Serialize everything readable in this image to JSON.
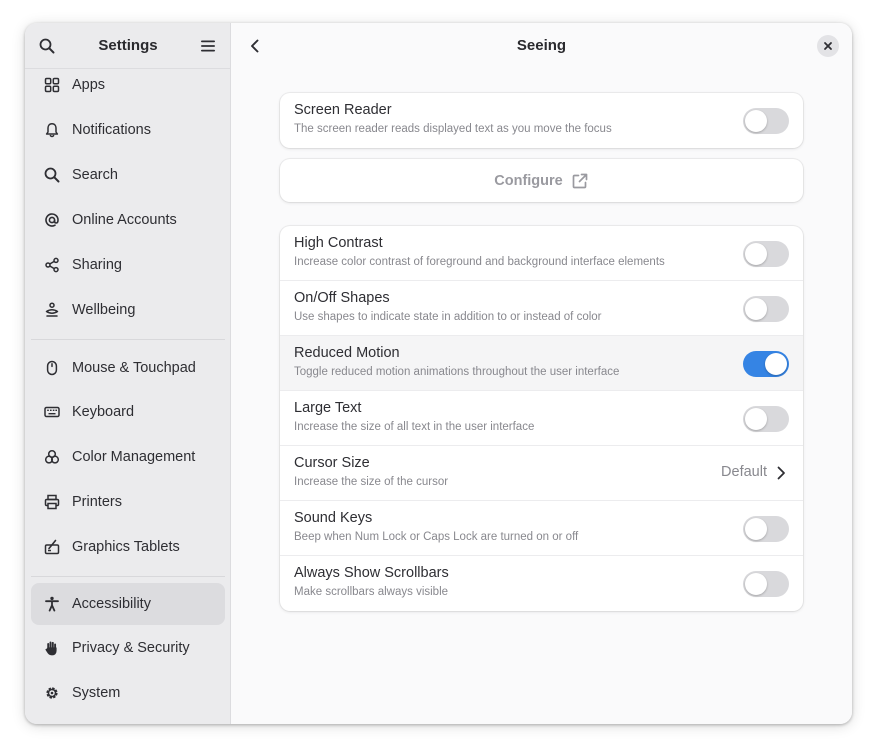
{
  "sidebar": {
    "title": "Settings",
    "items": [
      {
        "label": "Apps",
        "icon": "apps-grid-icon"
      },
      {
        "label": "Notifications",
        "icon": "bell-icon"
      },
      {
        "label": "Search",
        "icon": "search-icon"
      },
      {
        "label": "Online Accounts",
        "icon": "at-sign-icon"
      },
      {
        "label": "Sharing",
        "icon": "share-icon"
      },
      {
        "label": "Wellbeing",
        "icon": "wellbeing-icon"
      },
      {
        "label": "Mouse & Touchpad",
        "icon": "mouse-icon"
      },
      {
        "label": "Keyboard",
        "icon": "keyboard-icon"
      },
      {
        "label": "Color Management",
        "icon": "color-icon"
      },
      {
        "label": "Printers",
        "icon": "printer-icon"
      },
      {
        "label": "Graphics Tablets",
        "icon": "tablet-icon"
      },
      {
        "label": "Accessibility",
        "icon": "accessibility-icon",
        "active": true
      },
      {
        "label": "Privacy & Security",
        "icon": "hand-icon"
      },
      {
        "label": "System",
        "icon": "gear-icon"
      }
    ]
  },
  "main": {
    "title": "Seeing",
    "screen_reader": {
      "title": "Screen Reader",
      "subtitle": "The screen reader reads displayed text as you move the focus",
      "enabled": false
    },
    "configure": {
      "label": "Configure"
    },
    "rows": [
      {
        "title": "High Contrast",
        "subtitle": "Increase color contrast of foreground and background interface elements",
        "enabled": false
      },
      {
        "title": "On/Off Shapes",
        "subtitle": "Use shapes to indicate state in addition to or instead of color",
        "enabled": false
      },
      {
        "title": "Reduced Motion",
        "subtitle": "Toggle reduced motion animations throughout the user interface",
        "enabled": true
      },
      {
        "title": "Large Text",
        "subtitle": "Increase the size of all text in the user interface",
        "enabled": false
      },
      {
        "title": "Cursor Size",
        "subtitle": "Increase the size of the cursor",
        "value": "Default"
      },
      {
        "title": "Sound Keys",
        "subtitle": "Beep when Num Lock or Caps Lock are turned on or off",
        "enabled": false
      },
      {
        "title": "Always Show Scrollbars",
        "subtitle": "Make scrollbars always visible",
        "enabled": false
      }
    ]
  },
  "colors": {
    "accent": "#3584e4",
    "sidebar_bg": "#ebebed",
    "content_bg": "#fafafb"
  }
}
